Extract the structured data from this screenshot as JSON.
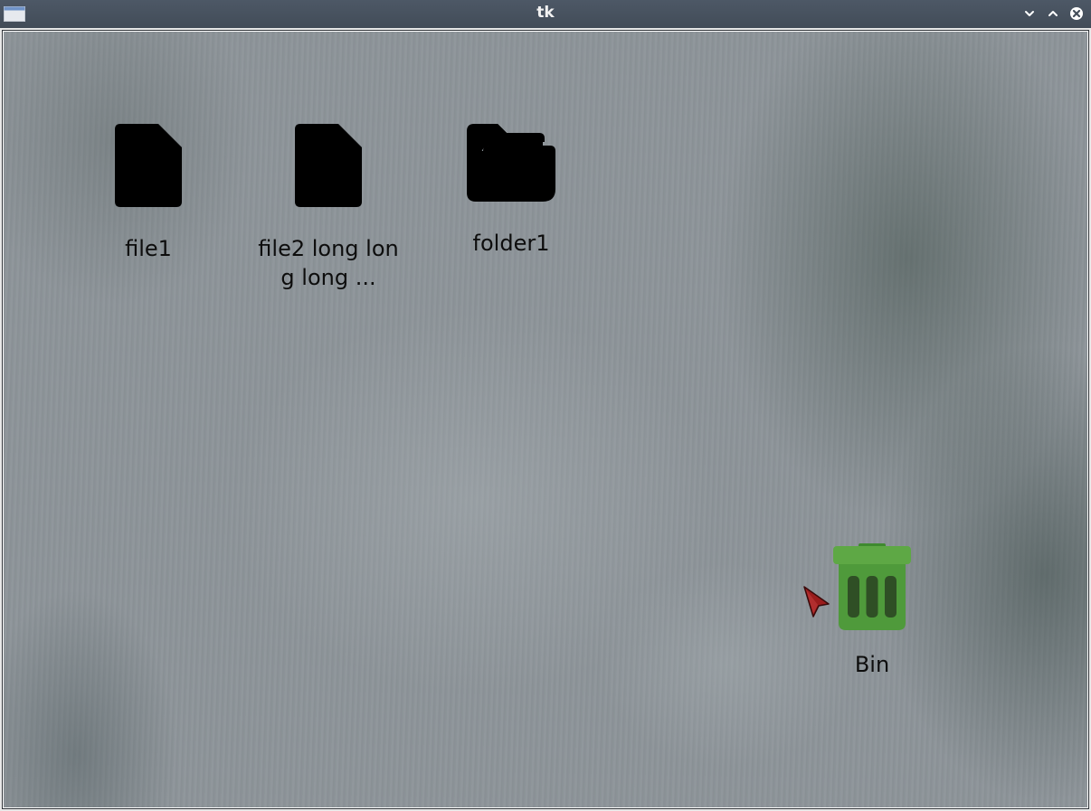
{
  "window": {
    "title": "tk"
  },
  "titlebar_buttons": {
    "minimize_icon": "chevron-down-icon",
    "maximize_icon": "chevron-up-icon",
    "close_icon": "close-icon"
  },
  "desktop": {
    "items": [
      {
        "label": "file1",
        "icon": "file-icon"
      },
      {
        "label": "file2 long long long ...",
        "icon": "file-icon"
      },
      {
        "label": "folder1",
        "icon": "folder-icon"
      },
      {
        "label": "Bin",
        "icon": "trash-bin-icon"
      }
    ]
  },
  "colors": {
    "titlebar": "#444e5a",
    "bin_green": "#4e9a3a",
    "icon_black": "#000000",
    "cursor_red": "#8b1a1a"
  }
}
